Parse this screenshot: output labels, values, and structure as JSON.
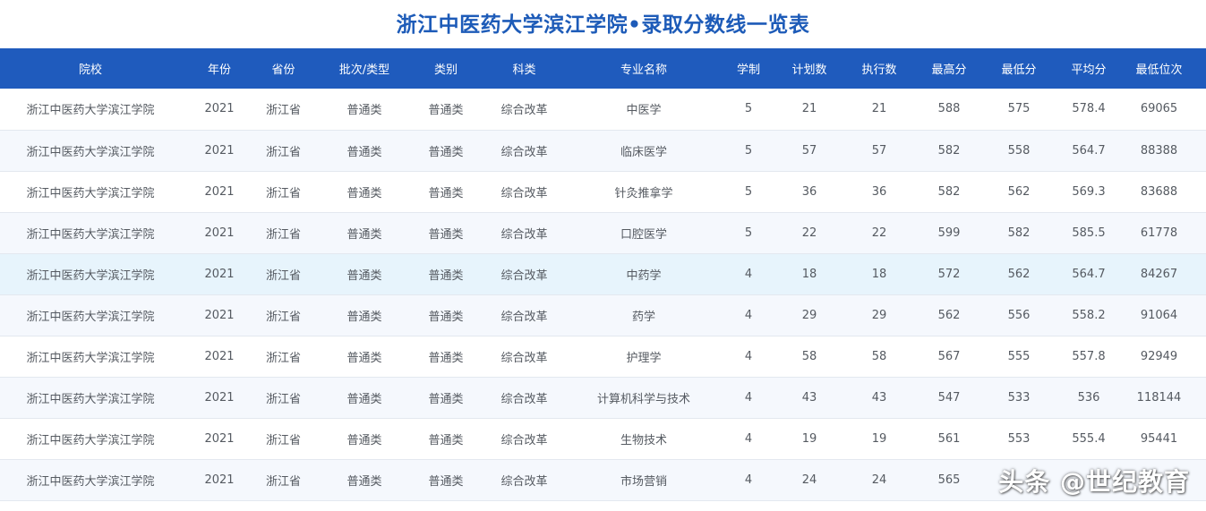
{
  "title": "浙江中医药大学滨江学院•录取分数线一览表",
  "columns": [
    "院校",
    "年份",
    "省份",
    "批次/类型",
    "类别",
    "科类",
    "专业名称",
    "学制",
    "计划数",
    "执行数",
    "最高分",
    "最低分",
    "平均分",
    "最低位次"
  ],
  "rows": [
    [
      "浙江中医药大学滨江学院",
      "2021",
      "浙江省",
      "普通类",
      "普通类",
      "综合改革",
      "中医学",
      "5",
      "21",
      "21",
      "588",
      "575",
      "578.4",
      "69065"
    ],
    [
      "浙江中医药大学滨江学院",
      "2021",
      "浙江省",
      "普通类",
      "普通类",
      "综合改革",
      "临床医学",
      "5",
      "57",
      "57",
      "582",
      "558",
      "564.7",
      "88388"
    ],
    [
      "浙江中医药大学滨江学院",
      "2021",
      "浙江省",
      "普通类",
      "普通类",
      "综合改革",
      "针灸推拿学",
      "5",
      "36",
      "36",
      "582",
      "562",
      "569.3",
      "83688"
    ],
    [
      "浙江中医药大学滨江学院",
      "2021",
      "浙江省",
      "普通类",
      "普通类",
      "综合改革",
      "口腔医学",
      "5",
      "22",
      "22",
      "599",
      "582",
      "585.5",
      "61778"
    ],
    [
      "浙江中医药大学滨江学院",
      "2021",
      "浙江省",
      "普通类",
      "普通类",
      "综合改革",
      "中药学",
      "4",
      "18",
      "18",
      "572",
      "562",
      "564.7",
      "84267"
    ],
    [
      "浙江中医药大学滨江学院",
      "2021",
      "浙江省",
      "普通类",
      "普通类",
      "综合改革",
      "药学",
      "4",
      "29",
      "29",
      "562",
      "556",
      "558.2",
      "91064"
    ],
    [
      "浙江中医药大学滨江学院",
      "2021",
      "浙江省",
      "普通类",
      "普通类",
      "综合改革",
      "护理学",
      "4",
      "58",
      "58",
      "567",
      "555",
      "557.8",
      "92949"
    ],
    [
      "浙江中医药大学滨江学院",
      "2021",
      "浙江省",
      "普通类",
      "普通类",
      "综合改革",
      "计算机科学与技术",
      "4",
      "43",
      "43",
      "547",
      "533",
      "536",
      "118144"
    ],
    [
      "浙江中医药大学滨江学院",
      "2021",
      "浙江省",
      "普通类",
      "普通类",
      "综合改革",
      "生物技术",
      "4",
      "19",
      "19",
      "561",
      "553",
      "555.4",
      "95441"
    ],
    [
      "浙江中医药大学滨江学院",
      "2021",
      "浙江省",
      "普通类",
      "普通类",
      "综合改革",
      "市场营销",
      "4",
      "24",
      "24",
      "565",
      "",
      "",
      ""
    ]
  ],
  "highlighted_row": 4,
  "watermark": "头条 @世纪教育",
  "colors": {
    "title": "#1d5bb8",
    "header_bg": "#1f5bbd",
    "row_alt_bg": "#f5f8fd",
    "row_highlight_bg": "#e7f4fc"
  }
}
